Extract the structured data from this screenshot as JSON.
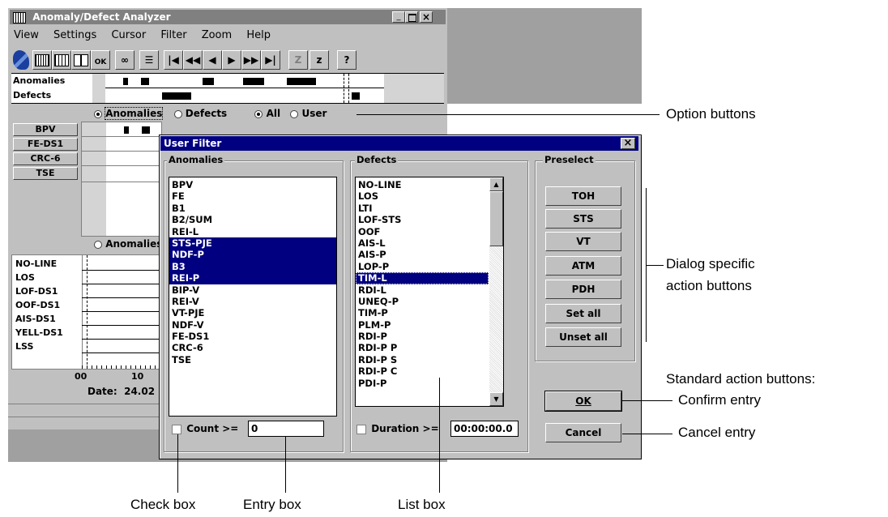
{
  "main_window": {
    "title": "Anomaly/Defect Analyzer",
    "menu": [
      "View",
      "Settings",
      "Cursor",
      "Filter",
      "Zoom",
      "Help"
    ],
    "toolbar": {
      "ok_badge": "OK",
      "z_outline": "Z",
      "z_solid": "z",
      "help": "?"
    },
    "timeline_rows": [
      "Anomalies",
      "Defects"
    ],
    "radio_row1": {
      "anomalies": "Anomalies",
      "defects": "Defects",
      "all": "All",
      "user": "User"
    },
    "anomaly_buttons": [
      "BPV",
      "FE-DS1",
      "CRC-6",
      "TSE"
    ],
    "radio_row2": {
      "anomalies": "Anomalies"
    },
    "defect_rows": [
      "NO-LINE",
      "LOS",
      "LOF-DS1",
      "OOF-DS1",
      "AIS-DS1",
      "YELL-DS1",
      "LSS"
    ],
    "axis_ticks": [
      "00",
      "10"
    ],
    "date_text": "Date:  24.02"
  },
  "dialog": {
    "title": "User Filter",
    "close_glyph": "×",
    "anomalies_group": "Anomalies",
    "anomalies_list": [
      "BPV",
      "FE",
      "B1",
      "B2/SUM",
      "REI-L",
      "STS-PJE",
      "NDF-P",
      "B3",
      "REI-P",
      "BIP-V",
      "REI-V",
      "VT-PJE",
      "NDF-V",
      "FE-DS1",
      "CRC-6",
      "TSE"
    ],
    "anomalies_selected": [
      "STS-PJE",
      "NDF-P",
      "B3",
      "REI-P"
    ],
    "defects_group": "Defects",
    "defects_list": [
      "NO-LINE",
      "LOS",
      "LTI",
      "LOF-STS",
      "OOF",
      "AIS-L",
      "AIS-P",
      "LOP-P",
      "TIM-L",
      "RDI-L",
      "UNEQ-P",
      "TIM-P",
      "PLM-P",
      "RDI-P",
      "RDI-P P",
      "RDI-P S",
      "RDI-P C",
      "PDI-P"
    ],
    "defects_selected": [
      "TIM-L"
    ],
    "preselect_group": "Preselect",
    "preselect_buttons": [
      "TOH",
      "STS",
      "VT",
      "ATM",
      "PDH",
      "Set all",
      "Unset all"
    ],
    "count_label": "Count >=",
    "count_value": "0",
    "duration_label": "Duration >=",
    "duration_value": "00:00:00.0",
    "ok_label": "OK",
    "cancel_label": "Cancel"
  },
  "callouts": {
    "option_buttons": "Option buttons",
    "dialog_specific_1": "Dialog specific",
    "dialog_specific_2": "action buttons",
    "standard_action": "Standard action buttons:",
    "confirm_entry": "Confirm entry",
    "cancel_entry": "Cancel entry",
    "check_box": "Check box",
    "entry_box": "Entry box",
    "list_box": "List box"
  }
}
